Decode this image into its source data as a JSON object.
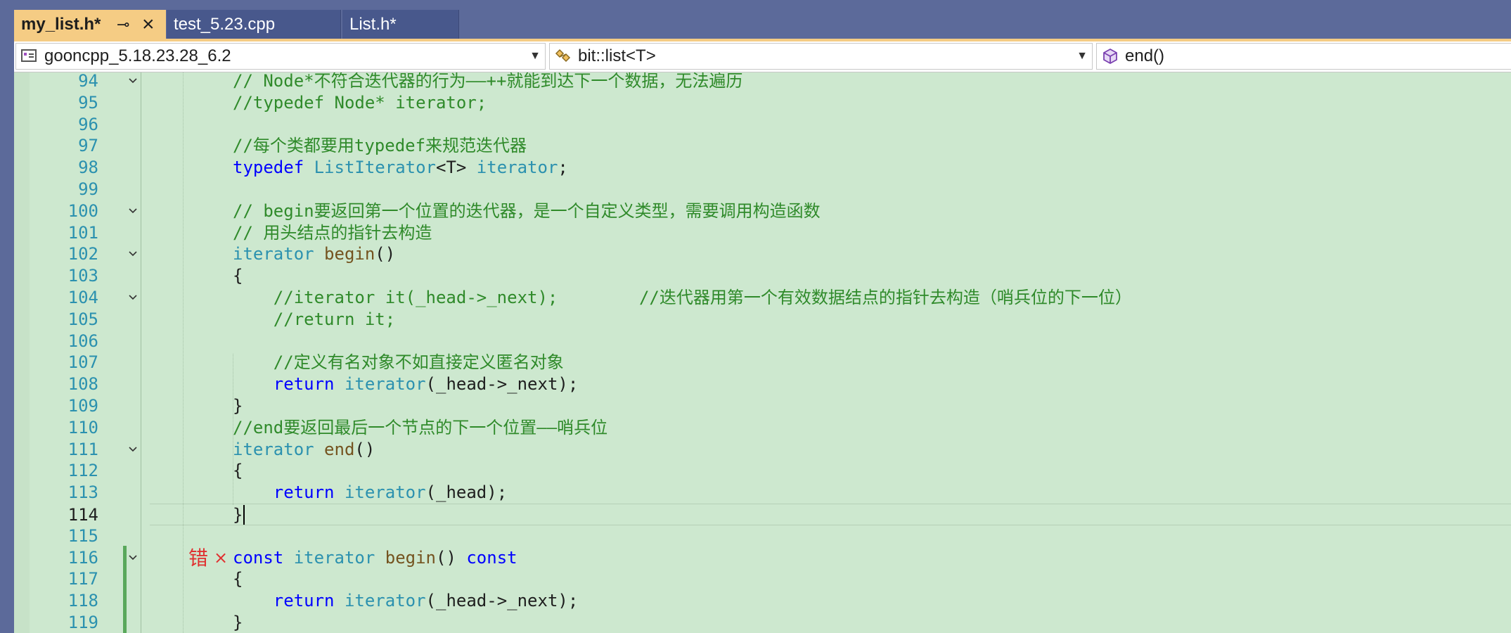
{
  "tabs": [
    {
      "label": "my_list.h*",
      "active": true,
      "pin_icon": "pin-icon",
      "close_icon": "close-icon"
    },
    {
      "label": "test_5.23.cpp",
      "active": false
    },
    {
      "label": "List.h*",
      "active": false
    }
  ],
  "navbar": {
    "project": "gooncpp_5.18.23.28_6.2",
    "scope": "bit::list<T>",
    "member": "end()"
  },
  "editor": {
    "current_line": "114",
    "error_annotation": "错",
    "error_symbol": "×",
    "lines": [
      {
        "n": "94",
        "t": "        // Node*不符合迭代器的行为——++就能到达下一个数据，无法遍历"
      },
      {
        "n": "95",
        "t": "        //typedef Node* iterator;"
      },
      {
        "n": "96",
        "t": ""
      },
      {
        "n": "97",
        "t": "        //每个类都要用typedef来规范迭代器"
      },
      {
        "n": "98",
        "t": "        typedef ListIterator<T> iterator;"
      },
      {
        "n": "99",
        "t": ""
      },
      {
        "n": "100",
        "t": "        // begin要返回第一个位置的迭代器，是一个自定义类型，需要调用构造函数"
      },
      {
        "n": "101",
        "t": "        // 用头结点的指针去构造"
      },
      {
        "n": "102",
        "t": "        iterator begin()"
      },
      {
        "n": "103",
        "t": "        {"
      },
      {
        "n": "104",
        "t": "            //iterator it(_head->_next);        //迭代器用第一个有效数据结点的指针去构造（哨兵位的下一位）"
      },
      {
        "n": "105",
        "t": "            //return it;"
      },
      {
        "n": "106",
        "t": ""
      },
      {
        "n": "107",
        "t": "            //定义有名对象不如直接定义匿名对象"
      },
      {
        "n": "108",
        "t": "            return iterator(_head->_next);"
      },
      {
        "n": "109",
        "t": "        }"
      },
      {
        "n": "110",
        "t": "        //end要返回最后一个节点的下一个位置——哨兵位"
      },
      {
        "n": "111",
        "t": "        iterator end()"
      },
      {
        "n": "112",
        "t": "        {"
      },
      {
        "n": "113",
        "t": "            return iterator(_head);"
      },
      {
        "n": "114",
        "t": "        }"
      },
      {
        "n": "115",
        "t": ""
      },
      {
        "n": "116",
        "t": "        const iterator begin() const"
      },
      {
        "n": "117",
        "t": "        {"
      },
      {
        "n": "118",
        "t": "            return iterator(_head->_next);"
      },
      {
        "n": "119",
        "t": "        }"
      }
    ]
  },
  "colors": {
    "editor_bg": "#cde8cf",
    "comment": "#2f8a2a",
    "keyword": "#0000ff",
    "type": "#2b91af",
    "function": "#74531f",
    "line_number": "#2b91af",
    "active_tab": "#f5cc84",
    "tab_strip": "#5c6a9a",
    "error": "#e03030"
  }
}
